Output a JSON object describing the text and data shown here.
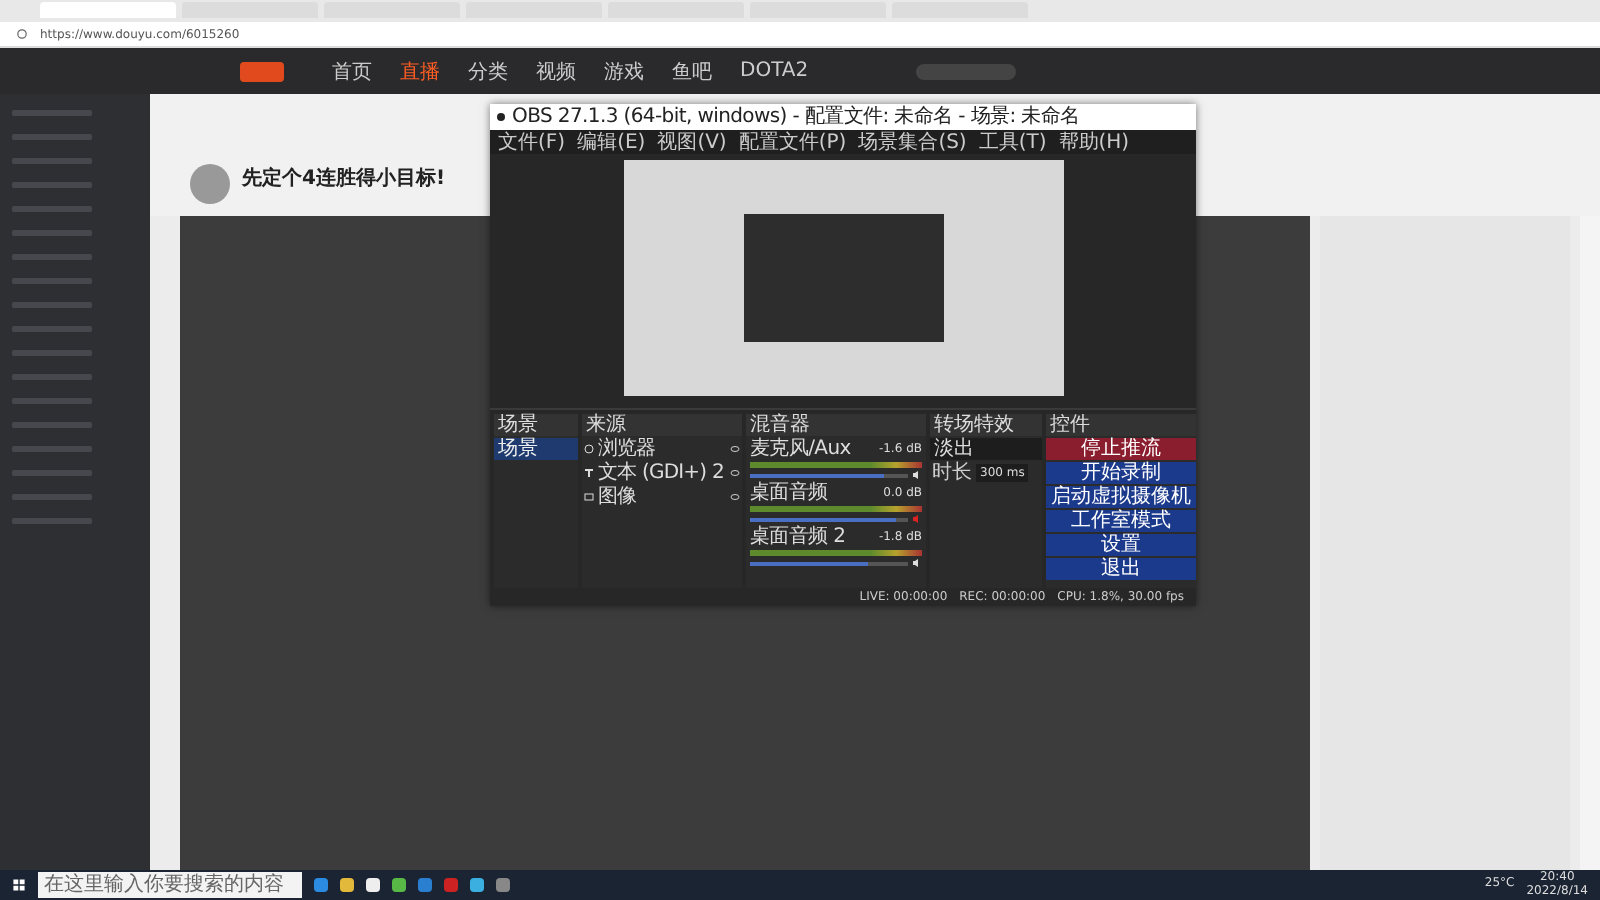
{
  "browser": {
    "tabs": [
      {
        "selected": true
      },
      {
        "selected": false
      },
      {
        "selected": false
      },
      {
        "selected": false
      },
      {
        "selected": false
      },
      {
        "selected": false
      },
      {
        "selected": false
      }
    ],
    "address": "https://www.douyu.com/6015260"
  },
  "site": {
    "nav": [
      {
        "label": "首页",
        "selected": false
      },
      {
        "label": "直播",
        "selected": true
      },
      {
        "label": "分类",
        "selected": false
      },
      {
        "label": "视频",
        "selected": false
      },
      {
        "label": "游戏",
        "selected": false
      },
      {
        "label": "鱼吧",
        "selected": false
      },
      {
        "label": "DOTA2",
        "selected": false
      }
    ],
    "streamer_title": "先定个4连胜得小目标!"
  },
  "obs": {
    "title": "OBS 27.1.3 (64-bit, windows) - 配置文件: 未命名 - 场景: 未命名",
    "menus": [
      "文件(F)",
      "编辑(E)",
      "视图(V)",
      "配置文件(P)",
      "场景集合(S)",
      "工具(T)",
      "帮助(H)"
    ],
    "scenes": {
      "title": "场景",
      "items": [
        {
          "label": "场景",
          "selected": true
        }
      ]
    },
    "sources": {
      "title": "来源",
      "items": [
        {
          "label": "浏览器",
          "kind": "browser"
        },
        {
          "label": "文本 (GDI+) 2",
          "kind": "text"
        },
        {
          "label": "图像",
          "kind": "image"
        }
      ]
    },
    "mixer": {
      "title": "混音器",
      "channels": [
        {
          "name": "麦克风/Aux",
          "reading": "-1.6 dB",
          "level": 0.85,
          "muted": false
        },
        {
          "name": "桌面音频",
          "reading": "0.0 dB",
          "level": 0.93,
          "muted": true
        },
        {
          "name": "桌面音频 2",
          "reading": "-1.8 dB",
          "level": 0.75,
          "muted": false
        }
      ]
    },
    "transitions": {
      "title": "转场特效",
      "transition": "淡出",
      "duration_label": "时长",
      "duration": "300 ms"
    },
    "controls": {
      "title": "控件",
      "buttons": [
        {
          "label": "停止推流",
          "kind": "stop"
        },
        {
          "label": "开始录制",
          "kind": "normal"
        },
        {
          "label": "启动虚拟摄像机",
          "kind": "normal"
        },
        {
          "label": "工作室模式",
          "kind": "normal"
        },
        {
          "label": "设置",
          "kind": "normal"
        },
        {
          "label": "退出",
          "kind": "normal"
        }
      ]
    },
    "status": {
      "live": "LIVE: 00:00:00",
      "rec": "REC: 00:00:00",
      "cpu": "CPU: 1.8%, 30.00 fps"
    }
  },
  "taskbar": {
    "search_placeholder": "在这里输入你要搜索的内容",
    "weather": "25°C",
    "time": "20:40",
    "date": "2022/8/14"
  }
}
